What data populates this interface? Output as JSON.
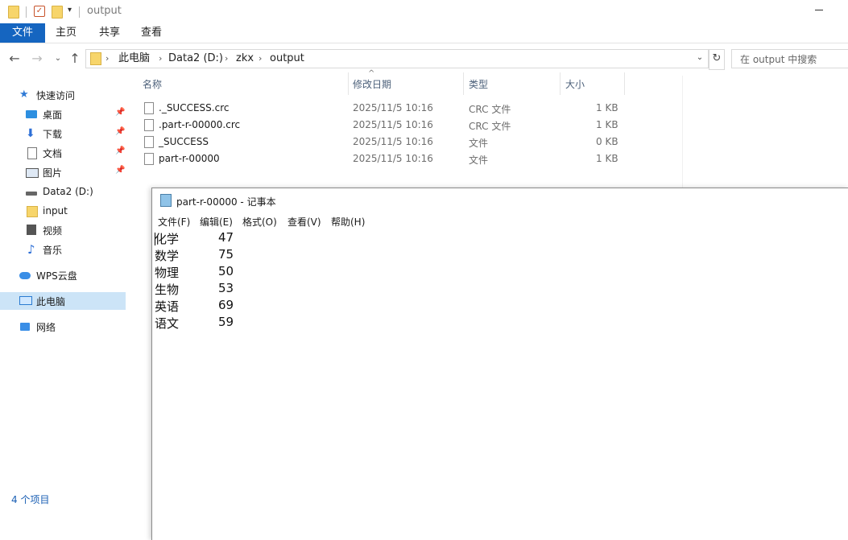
{
  "titlebar": {
    "title": "output"
  },
  "ribbon": {
    "tabs": [
      "文件",
      "主页",
      "共享",
      "查看"
    ]
  },
  "address": {
    "crumbs": [
      "此电脑",
      "Data2 (D:)",
      "zkx",
      "output"
    ]
  },
  "search": {
    "placeholder": "在 output 中搜索"
  },
  "sidebar": {
    "items": [
      {
        "label": "快速访问",
        "icon": "star-icon"
      },
      {
        "label": "桌面",
        "icon": "desktop-icon",
        "pinned": true
      },
      {
        "label": "下载",
        "icon": "download-icon",
        "pinned": true
      },
      {
        "label": "文档",
        "icon": "document-icon",
        "pinned": true
      },
      {
        "label": "图片",
        "icon": "pictures-icon",
        "pinned": true
      },
      {
        "label": "Data2 (D:)",
        "icon": "drive-icon"
      },
      {
        "label": "input",
        "icon": "folder-icon"
      },
      {
        "label": "视频",
        "icon": "video-icon"
      },
      {
        "label": "音乐",
        "icon": "music-icon"
      },
      {
        "label": "WPS云盘",
        "icon": "cloud-icon"
      },
      {
        "label": "此电脑",
        "icon": "computer-icon",
        "selected": true
      },
      {
        "label": "网络",
        "icon": "network-icon"
      }
    ]
  },
  "columns": {
    "name": "名称",
    "date": "修改日期",
    "type": "类型",
    "size": "大小"
  },
  "files": [
    {
      "name": "._SUCCESS.crc",
      "date": "2025/11/5 10:16",
      "type": "CRC 文件",
      "size": "1 KB"
    },
    {
      "name": ".part-r-00000.crc",
      "date": "2025/11/5 10:16",
      "type": "CRC 文件",
      "size": "1 KB"
    },
    {
      "name": "_SUCCESS",
      "date": "2025/11/5 10:16",
      "type": "文件",
      "size": "0 KB"
    },
    {
      "name": "part-r-00000",
      "date": "2025/11/5 10:16",
      "type": "文件",
      "size": "1 KB"
    }
  ],
  "status": {
    "text": "4 个项目"
  },
  "notepad": {
    "title": "part-r-00000 - 记事本",
    "menu": [
      "文件(F)",
      "编辑(E)",
      "格式(O)",
      "查看(V)",
      "帮助(H)"
    ],
    "lines": [
      {
        "subject": "化学",
        "score": "47"
      },
      {
        "subject": "数学",
        "score": "75"
      },
      {
        "subject": "物理",
        "score": "50"
      },
      {
        "subject": "生物",
        "score": "53"
      },
      {
        "subject": "英语",
        "score": "69"
      },
      {
        "subject": "语文",
        "score": "59"
      }
    ]
  },
  "colors": {
    "accent": "#1565c0",
    "selection": "#cce4f7"
  }
}
